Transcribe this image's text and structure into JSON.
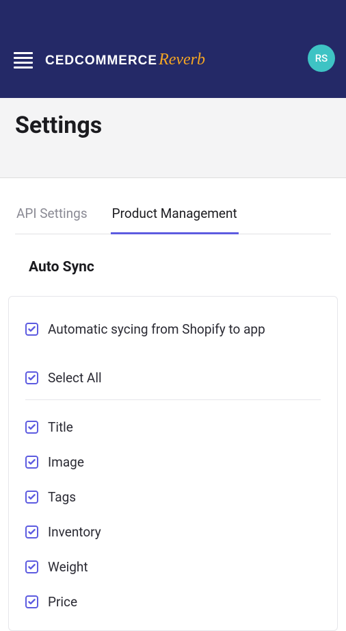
{
  "header": {
    "logo_main": "CEDCOMMERCE",
    "logo_sub": "Reverb",
    "avatar_initials": "RS"
  },
  "page": {
    "title": "Settings"
  },
  "tabs": {
    "api": "API Settings",
    "product": "Product Management"
  },
  "section": {
    "title": "Auto Sync"
  },
  "options": {
    "auto_sync": "Automatic sycing from Shopify to app",
    "select_all": "Select All",
    "items": {
      "title": "Title",
      "image": "Image",
      "tags": "Tags",
      "inventory": "Inventory",
      "weight": "Weight",
      "price": "Price"
    }
  }
}
